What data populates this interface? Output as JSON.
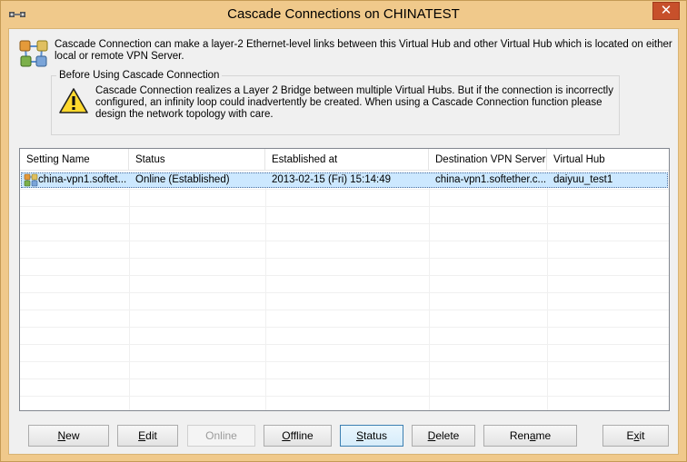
{
  "window": {
    "title": "Cascade Connections on CHINATEST",
    "close_label": "✕"
  },
  "intro": {
    "line1": "Cascade Connection can make a layer-2 Ethernet-level links between this Virtual Hub and other Virtual Hub which is located on either",
    "line2": "local or remote VPN Server."
  },
  "warning": {
    "legend": "Before Using Cascade Connection",
    "line1": "Cascade Connection realizes a Layer 2 Bridge between multiple Virtual Hubs. But if the connection is incorrectly",
    "line2": "configured, an infinity loop could inadvertently be created. When using a Cascade Connection function please",
    "line3": "design the network topology with care."
  },
  "table": {
    "columns": [
      "Setting Name",
      "Status",
      "Established at",
      "Destination VPN Server",
      "Virtual Hub"
    ],
    "rows": [
      {
        "setting_name": "china-vpn1.softet...",
        "status": "Online (Established)",
        "established_at": "2013-02-15 (Fri) 15:14:49",
        "destination": "china-vpn1.softether.c...",
        "virtual_hub": "daiyuu_test1"
      }
    ]
  },
  "buttons": {
    "new": {
      "pre": "",
      "u": "N",
      "post": "ew"
    },
    "edit": {
      "pre": "",
      "u": "E",
      "post": "dit"
    },
    "online": {
      "pre": "",
      "u": "",
      "post": "Online"
    },
    "offline": {
      "pre": "",
      "u": "O",
      "post": "ffline"
    },
    "status": {
      "pre": "",
      "u": "S",
      "post": "tatus"
    },
    "delete": {
      "pre": "",
      "u": "D",
      "post": "elete"
    },
    "rename": {
      "pre": "Ren",
      "u": "a",
      "post": "me"
    },
    "exit": {
      "pre": "E",
      "u": "x",
      "post": "it"
    }
  }
}
